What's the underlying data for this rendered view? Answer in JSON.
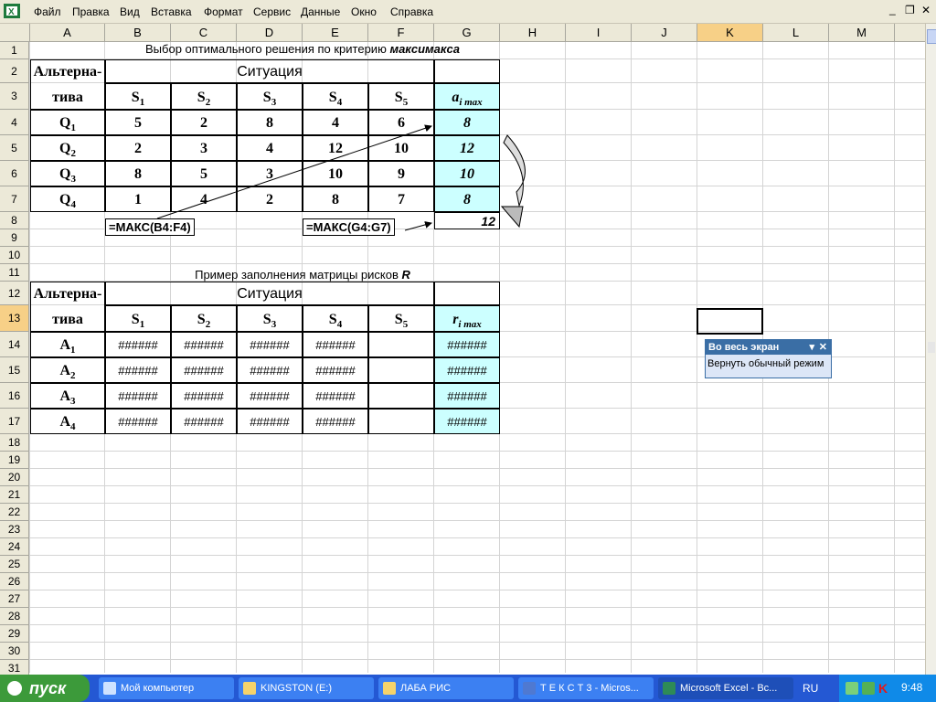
{
  "menu": {
    "items": [
      "Файл",
      "Правка",
      "Вид",
      "Вставка",
      "Формат",
      "Сервис",
      "Данные",
      "Окно",
      "Справка"
    ],
    "window_controls": [
      "_",
      "❐",
      "✕"
    ]
  },
  "columns": [
    "A",
    "B",
    "C",
    "D",
    "E",
    "F",
    "G",
    "H",
    "I",
    "J",
    "K",
    "L",
    "M"
  ],
  "rows": [
    "1",
    "2",
    "3",
    "4",
    "5",
    "6",
    "7",
    "8",
    "9",
    "10",
    "11",
    "12",
    "13",
    "14",
    "15",
    "16",
    "17",
    "18",
    "19",
    "20",
    "21",
    "22",
    "23",
    "24",
    "25",
    "26",
    "27",
    "28",
    "29",
    "30",
    "31"
  ],
  "sheet": {
    "title1": "Выбор оптимального решения по критерию",
    "title1_bold": "максимакса",
    "alt_header": "Альтерна-",
    "alt_header2": "тива",
    "situation": "Ситуация",
    "s_labels": [
      "S",
      "S",
      "S",
      "S",
      "S"
    ],
    "s_subs": [
      "1",
      "2",
      "3",
      "4",
      "5"
    ],
    "amax": "a",
    "amax_sub": "i max",
    "q_labels": [
      "Q",
      "Q",
      "Q",
      "Q"
    ],
    "q_subs": [
      "1",
      "2",
      "3",
      "4"
    ],
    "matrix": [
      [
        "5",
        "2",
        "8",
        "4",
        "6"
      ],
      [
        "2",
        "3",
        "4",
        "12",
        "10"
      ],
      [
        "8",
        "5",
        "3",
        "10",
        "9"
      ],
      [
        "1",
        "4",
        "2",
        "8",
        "7"
      ]
    ],
    "g_values": [
      "8",
      "12",
      "10",
      "8"
    ],
    "g8": "12",
    "formula1": "=МАКС(B4:F4)",
    "formula2": "=МАКС(G4:G7)",
    "title2": "Пример заполнения матрицы рисков",
    "title2_bold": "R",
    "rmax": "r",
    "rmax_sub": "i max",
    "a_labels": [
      "A",
      "A",
      "A",
      "A"
    ],
    "a_subs": [
      "1",
      "2",
      "3",
      "4"
    ],
    "hash": "######"
  },
  "fullscreen_bar": {
    "title": "Во весь экран",
    "button": "Вернуть обычный режим"
  },
  "taskbar": {
    "start": "пуск",
    "tasks": [
      "Мой компьютер",
      "KINGSTON (E:)",
      "ЛАБА РИС",
      "Т Е К С Т 3 - Micros...",
      "Microsoft Excel - Вс..."
    ],
    "lang": "RU",
    "clock": "9:48"
  },
  "colors": {
    "accent": "#3a6ea5",
    "highlight": "#ccffff",
    "selected_header": "#f7d087"
  }
}
